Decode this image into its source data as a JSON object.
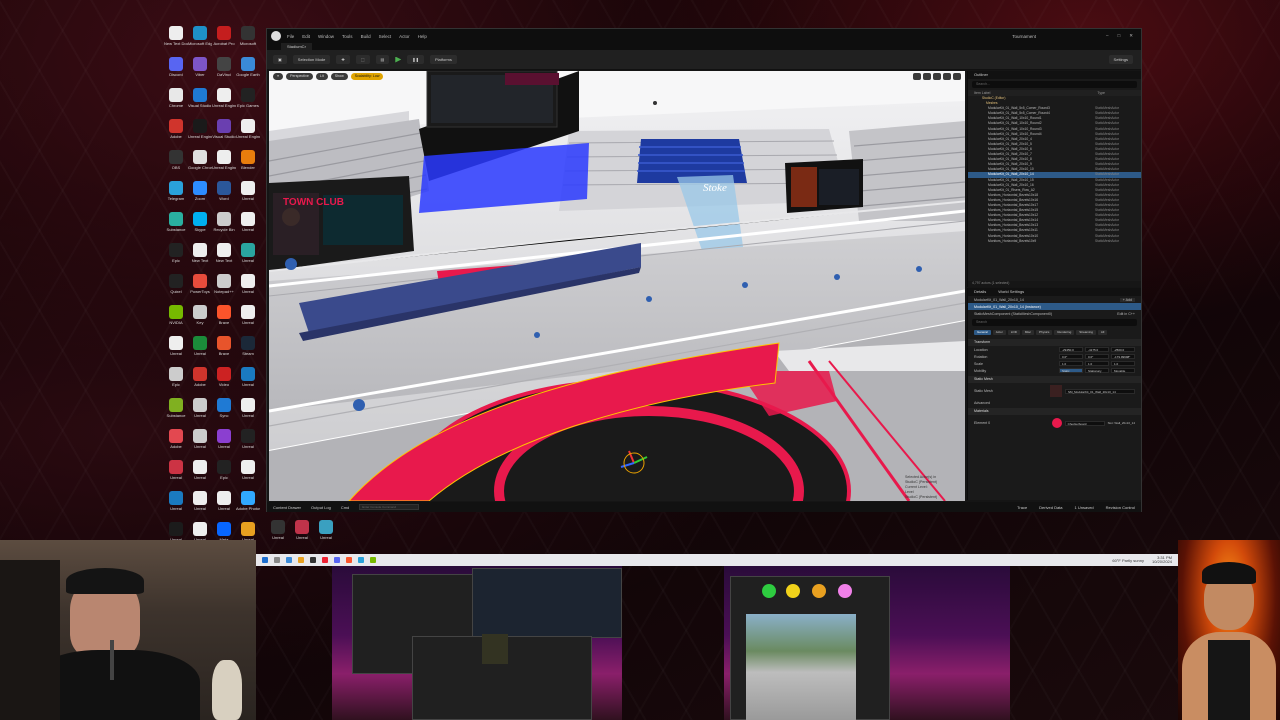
{
  "desktop": {
    "icons": [
      {
        "label": "New Text Document",
        "color": "#eeeeee"
      },
      {
        "label": "Microsoft Edge",
        "color": "#1e90c8"
      },
      {
        "label": "Acrobat Pro",
        "color": "#c41e1e"
      },
      {
        "label": "Microsoft",
        "color": "#333333"
      },
      {
        "label": "Discord",
        "color": "#5865f2"
      },
      {
        "label": "Viber",
        "color": "#7d55c7"
      },
      {
        "label": "DaVinci",
        "color": "#444444"
      },
      {
        "label": "Google Earth",
        "color": "#3a8ad8"
      },
      {
        "label": "Chrome",
        "color": "#e8e8e8"
      },
      {
        "label": "Visual Studio Code",
        "color": "#1f7ad4"
      },
      {
        "label": "Unreal Engine",
        "color": "#eeeeee"
      },
      {
        "label": "Epic Games",
        "color": "#222222"
      },
      {
        "label": "Adobe",
        "color": "#d0342c"
      },
      {
        "label": "Unreal Engine 5",
        "color": "#1a1a1a"
      },
      {
        "label": "Visual Studio",
        "color": "#6a3fb0"
      },
      {
        "label": "Unreal Engine",
        "color": "#eeeeee"
      },
      {
        "label": "OBS",
        "color": "#333333"
      },
      {
        "label": "Google Chrome",
        "color": "#e0e0e0"
      },
      {
        "label": "Unreal Engine",
        "color": "#eeeeee"
      },
      {
        "label": "Blender",
        "color": "#e87d0d"
      },
      {
        "label": "Telegram",
        "color": "#2aa1da"
      },
      {
        "label": "Zoom",
        "color": "#2d8cff"
      },
      {
        "label": "Word",
        "color": "#2b579a"
      },
      {
        "label": "Unreal",
        "color": "#eeeeee"
      },
      {
        "label": "Substance",
        "color": "#2ab0a0"
      },
      {
        "label": "Skype",
        "color": "#00aff0"
      },
      {
        "label": "Recycle Bin",
        "color": "#cccccc"
      },
      {
        "label": "Unreal",
        "color": "#eeeeee"
      },
      {
        "label": "Epic",
        "color": "#222222"
      },
      {
        "label": "New Text",
        "color": "#eeeeee"
      },
      {
        "label": "New Text",
        "color": "#eeeeee"
      },
      {
        "label": "Unreal",
        "color": "#2aa5a0"
      },
      {
        "label": "Quixel",
        "color": "#222222"
      },
      {
        "label": "PowerToys",
        "color": "#e74c3c"
      },
      {
        "label": "Notepad++",
        "color": "#cccccc"
      },
      {
        "label": "Unreal",
        "color": "#eeeeee"
      },
      {
        "label": "NVIDIA",
        "color": "#76b900"
      },
      {
        "label": "Key",
        "color": "#cccccc"
      },
      {
        "label": "Brave",
        "color": "#fb542b"
      },
      {
        "label": "Unreal",
        "color": "#eeeeee"
      },
      {
        "label": "Unreal",
        "color": "#eeeeee"
      },
      {
        "label": "Unreal",
        "color": "#1b8b3a"
      },
      {
        "label": "Brave",
        "color": "#e8542b"
      },
      {
        "label": "Steam",
        "color": "#1b2838"
      },
      {
        "label": "Epic",
        "color": "#cccccc"
      },
      {
        "label": "Adobe",
        "color": "#d0342c"
      },
      {
        "label": "Video",
        "color": "#cc2222"
      },
      {
        "label": "Unreal",
        "color": "#1a7ac0"
      },
      {
        "label": "Substance",
        "color": "#80b020"
      },
      {
        "label": "Unreal",
        "color": "#cccccc"
      },
      {
        "label": "Sync",
        "color": "#1f7ad4"
      },
      {
        "label": "Unreal",
        "color": "#eeeeee"
      },
      {
        "label": "Adobe",
        "color": "#e34850"
      },
      {
        "label": "Unreal",
        "color": "#cccccc"
      },
      {
        "label": "Unreal",
        "color": "#8b3fd0"
      },
      {
        "label": "Unreal",
        "color": "#222222"
      },
      {
        "label": "Unreal",
        "color": "#cc3344"
      },
      {
        "label": "Unreal",
        "color": "#eeeeee"
      },
      {
        "label": "Epic",
        "color": "#222222"
      },
      {
        "label": "Unreal",
        "color": "#eeeeee"
      },
      {
        "label": "Unreal",
        "color": "#1a7ac0"
      },
      {
        "label": "Unreal",
        "color": "#eeeeee"
      },
      {
        "label": "Unreal",
        "color": "#eeeeee"
      },
      {
        "label": "Adobe Photoshop",
        "color": "#31a8ff"
      },
      {
        "label": "Unreal",
        "color": "#1b1b1b"
      },
      {
        "label": "Unreal",
        "color": "#eeeeee"
      },
      {
        "label": "Meta",
        "color": "#0866ff"
      },
      {
        "label": "Unreal",
        "color": "#e8a020"
      },
      {
        "label": "Discord",
        "color": "#5865f2"
      },
      {
        "label": "Unreal",
        "color": "#cc3344"
      }
    ],
    "row2": [
      {
        "label": "Unreal",
        "color": "#333333"
      },
      {
        "label": "Unreal",
        "color": "#c0334a"
      },
      {
        "label": "Unreal",
        "color": "#3aa0c0"
      }
    ]
  },
  "editor": {
    "menu": [
      "File",
      "Edit",
      "Window",
      "Tools",
      "Build",
      "Select",
      "Actor",
      "Help"
    ],
    "project_name": "Tournament",
    "level_tab": "StadiumCr",
    "toolbar": {
      "selection_mode": "Selection Mode",
      "platforms": "Platforms",
      "settings": "Settings"
    },
    "viewport": {
      "buttons": [
        "Perspective",
        "Lit",
        "Show",
        "Scalability: Low"
      ],
      "info_lines": [
        "Selected Actor(s) in",
        "StudioC (Persistent)",
        "Current Level:",
        "Level",
        "StudioC (Persistent)"
      ]
    },
    "bottom": {
      "tabs": [
        "Content Drawer",
        "Output Log",
        "Cmd"
      ],
      "cmd_placeholder": "Enter Console Command",
      "right": [
        "Trace",
        "Derived Data",
        "1 Unsaved",
        "Revision Control"
      ]
    },
    "outliner": {
      "title": "Outliner",
      "search_placeholder": "Search...",
      "col_label": "Item Label",
      "col_type": "Type",
      "folders": [
        "StudioC (Editor)",
        "Meshes"
      ],
      "rows": [
        {
          "label": "ModularKit_01_Wall_5x5_Corner_Round3",
          "type": "StaticMeshActor"
        },
        {
          "label": "ModularKit_01_Wall_5x5_Corner_Round4",
          "type": "StaticMeshActor"
        },
        {
          "label": "ModularKit_01_Wall_10x10_Round1",
          "type": "StaticMeshActor"
        },
        {
          "label": "ModularKit_01_Wall_10x10_Round2",
          "type": "StaticMeshActor"
        },
        {
          "label": "ModularKit_01_Wall_10x10_Round3",
          "type": "StaticMeshActor"
        },
        {
          "label": "ModularKit_01_Wall_10x10_Round4",
          "type": "StaticMeshActor"
        },
        {
          "label": "ModularKit_01_Wall_20x10_4",
          "type": "StaticMeshActor"
        },
        {
          "label": "ModularKit_01_Wall_20x10_5",
          "type": "StaticMeshActor"
        },
        {
          "label": "ModularKit_01_Wall_20x10_6",
          "type": "StaticMeshActor"
        },
        {
          "label": "ModularKit_01_Wall_20x10_7",
          "type": "StaticMeshActor"
        },
        {
          "label": "ModularKit_01_Wall_20x10_8",
          "type": "StaticMeshActor"
        },
        {
          "label": "ModularKit_01_Wall_20x10_9",
          "type": "StaticMeshActor"
        },
        {
          "label": "ModularKit_01_Wall_20x10_10",
          "type": "StaticMeshActor"
        },
        {
          "label": "ModularKit_01_Wall_20x10_14",
          "type": "StaticMeshActor",
          "selected": true
        },
        {
          "label": "ModularKit_01_Wall_20x10_15",
          "type": "StaticMeshActor"
        },
        {
          "label": "ModularKit_01_Wall_20x10_16",
          "type": "StaticMeshActor"
        },
        {
          "label": "ModularKit_01_Risers_Row_A2",
          "type": "StaticMeshActor"
        },
        {
          "label": "Monitors_Horizontal_Bezels10x18",
          "type": "StaticMeshActor"
        },
        {
          "label": "Monitors_Horizontal_Bezels10x16",
          "type": "StaticMeshActor"
        },
        {
          "label": "Monitors_Horizontal_Bezels10x17",
          "type": "StaticMeshActor"
        },
        {
          "label": "Monitors_Horizontal_Bezels10x15",
          "type": "StaticMeshActor"
        },
        {
          "label": "Monitors_Horizontal_Bezels10x12",
          "type": "StaticMeshActor"
        },
        {
          "label": "Monitors_Horizontal_Bezels10x14",
          "type": "StaticMeshActor"
        },
        {
          "label": "Monitors_Horizontal_Bezels10x13",
          "type": "StaticMeshActor"
        },
        {
          "label": "Monitors_Horizontal_Bezels10x11",
          "type": "StaticMeshActor"
        },
        {
          "label": "Monitors_Horizontal_Bezels10x10",
          "type": "StaticMeshActor"
        },
        {
          "label": "Monitors_Horizontal_Bezels10x9",
          "type": "StaticMeshActor"
        }
      ],
      "footer": "4,797 actors (1 selected)"
    },
    "details": {
      "tabs": [
        "Details",
        "World Settings"
      ],
      "actor_name": "ModularKit_01_Wall_20x10_14",
      "add_label": "+ Add",
      "instance_label": "ModularKit_01_Wall_20x10_14 (Instance)",
      "component_label": "StaticMeshComponent (StaticMeshComponent0)",
      "edit_label": "Edit in C++",
      "search_placeholder": "Search",
      "categories": [
        "General",
        "Actor",
        "LOD",
        "Misc",
        "Physics",
        "Rendering",
        "Streaming",
        "All"
      ],
      "transform_title": "Transform",
      "location_label": "Location",
      "location": [
        "-29450.0",
        "-4175.0",
        "-2500.0"
      ],
      "rotation_label": "Rotation",
      "rotation": [
        "0.0°",
        "0.0°",
        "-179.99998°"
      ],
      "scale_label": "Scale",
      "scale": [
        "1.0",
        "1.0",
        "1.0"
      ],
      "mobility_label": "Mobility",
      "mobility": [
        "Static",
        "Stationary",
        "Movable"
      ],
      "static_mesh_title": "Static Mesh",
      "static_mesh_label": "Static Mesh",
      "static_mesh_value": "SM_ModularKit_01_Wall_20x10_14",
      "advanced_label": "Advanced",
      "materials_title": "Materials",
      "element_label": "Element 0",
      "material_value": "Checkerboard",
      "slot_label": "Slot: Wall_20x10_14",
      "accent": "#e8194c"
    }
  },
  "taskbar": {
    "weather": "60°F Partly sunny",
    "time": "3:31 PM",
    "date": "10/20/2024"
  },
  "scene": {
    "banner_text": "TOWN CLUB",
    "screen_text": "Stoke",
    "colors": {
      "arena": "#e8e8ea",
      "ring": "#e8194c",
      "stage_blue": "#3a4a8c",
      "screen_blue": "#2a3aff",
      "seat_blue": "#1e3aa0"
    }
  }
}
